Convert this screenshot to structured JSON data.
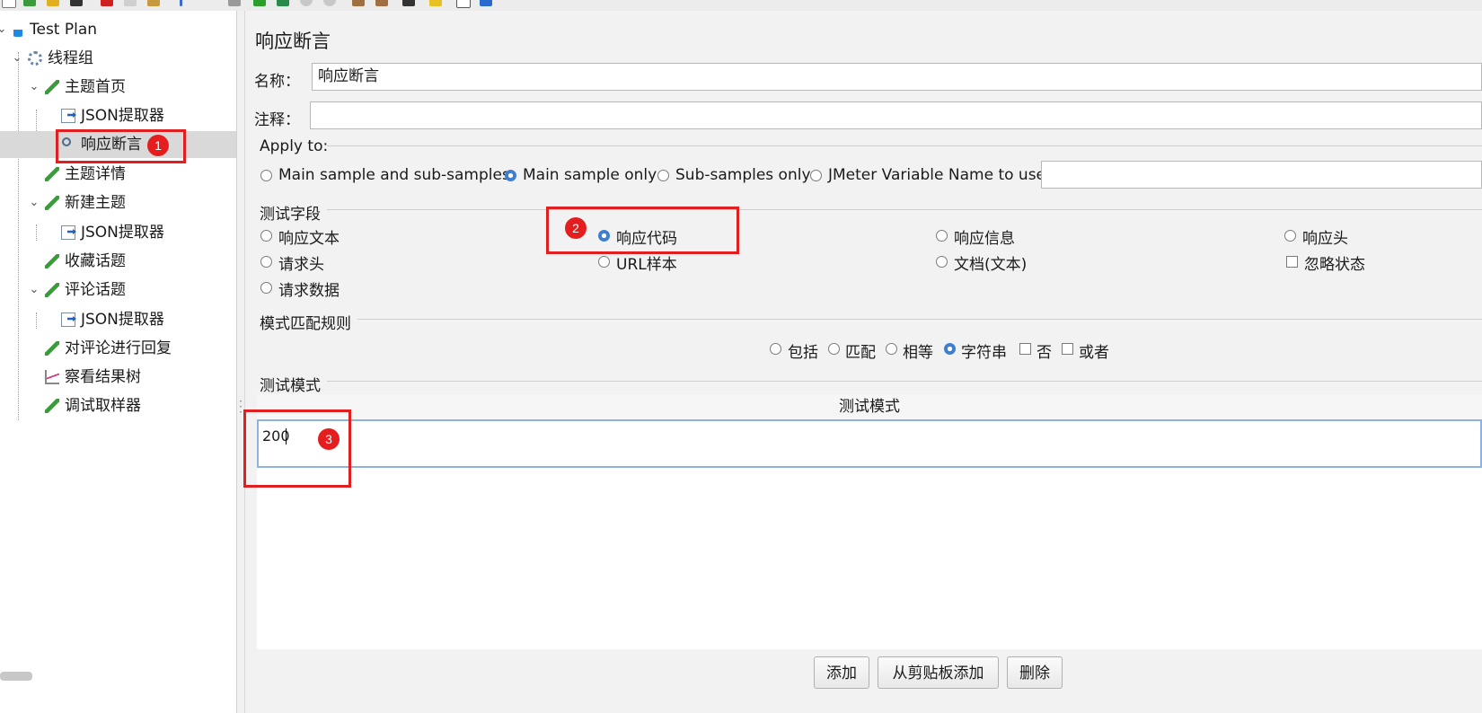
{
  "tree": {
    "nodes": [
      {
        "label": "Test Plan",
        "icon": "flask-icon"
      },
      {
        "label": "线程组",
        "icon": "gear-icon"
      },
      {
        "label": "主题首页",
        "icon": "pen-icon"
      },
      {
        "label": "JSON提取器",
        "icon": "doc-arrow-icon"
      },
      {
        "label": "响应断言",
        "icon": "magnifier-icon"
      },
      {
        "label": "主题详情",
        "icon": "pen-icon"
      },
      {
        "label": "新建主题",
        "icon": "pen-icon"
      },
      {
        "label": "JSON提取器",
        "icon": "doc-arrow-icon"
      },
      {
        "label": "收藏话题",
        "icon": "pen-icon"
      },
      {
        "label": "评论话题",
        "icon": "pen-icon"
      },
      {
        "label": "JSON提取器",
        "icon": "doc-arrow-icon"
      },
      {
        "label": "对评论进行回复",
        "icon": "pen-icon"
      },
      {
        "label": "察看结果树",
        "icon": "graph-icon"
      },
      {
        "label": "调试取样器",
        "icon": "pen-icon"
      }
    ],
    "selected": "响应断言"
  },
  "annotations": {
    "badge1": "1",
    "badge2": "2",
    "badge3": "3",
    "color": "#e02020"
  },
  "panel": {
    "title": "响应断言",
    "name_label": "名称：",
    "name_value": "响应断言",
    "comment_label": "注释：",
    "comment_value": "",
    "apply_to": {
      "label": "Apply to:",
      "options": [
        "Main sample and sub-samples",
        "Main sample only",
        "Sub-samples only",
        "JMeter Variable Name to use"
      ],
      "selected": "Main sample only",
      "var_value": ""
    },
    "field_to_test": {
      "label": "测试字段",
      "options": [
        "响应文本",
        "响应代码",
        "响应信息",
        "响应头",
        "请求头",
        "URL样本",
        "文档(文本)",
        "忽略状态",
        "请求数据"
      ],
      "selected": "响应代码",
      "ignore_status_checked": false
    },
    "pattern_rules": {
      "label": "模式匹配规则",
      "options": [
        "包括",
        "匹配",
        "相等",
        "字符串",
        "否",
        "或者"
      ],
      "selected": "字符串",
      "not_checked": false,
      "or_checked": false
    },
    "patterns": {
      "label": "测试模式",
      "column": "测试模式",
      "rows": [
        "200"
      ]
    },
    "buttons": {
      "add": "添加",
      "add_clipboard": "从剪贴板添加",
      "delete": "删除"
    }
  }
}
